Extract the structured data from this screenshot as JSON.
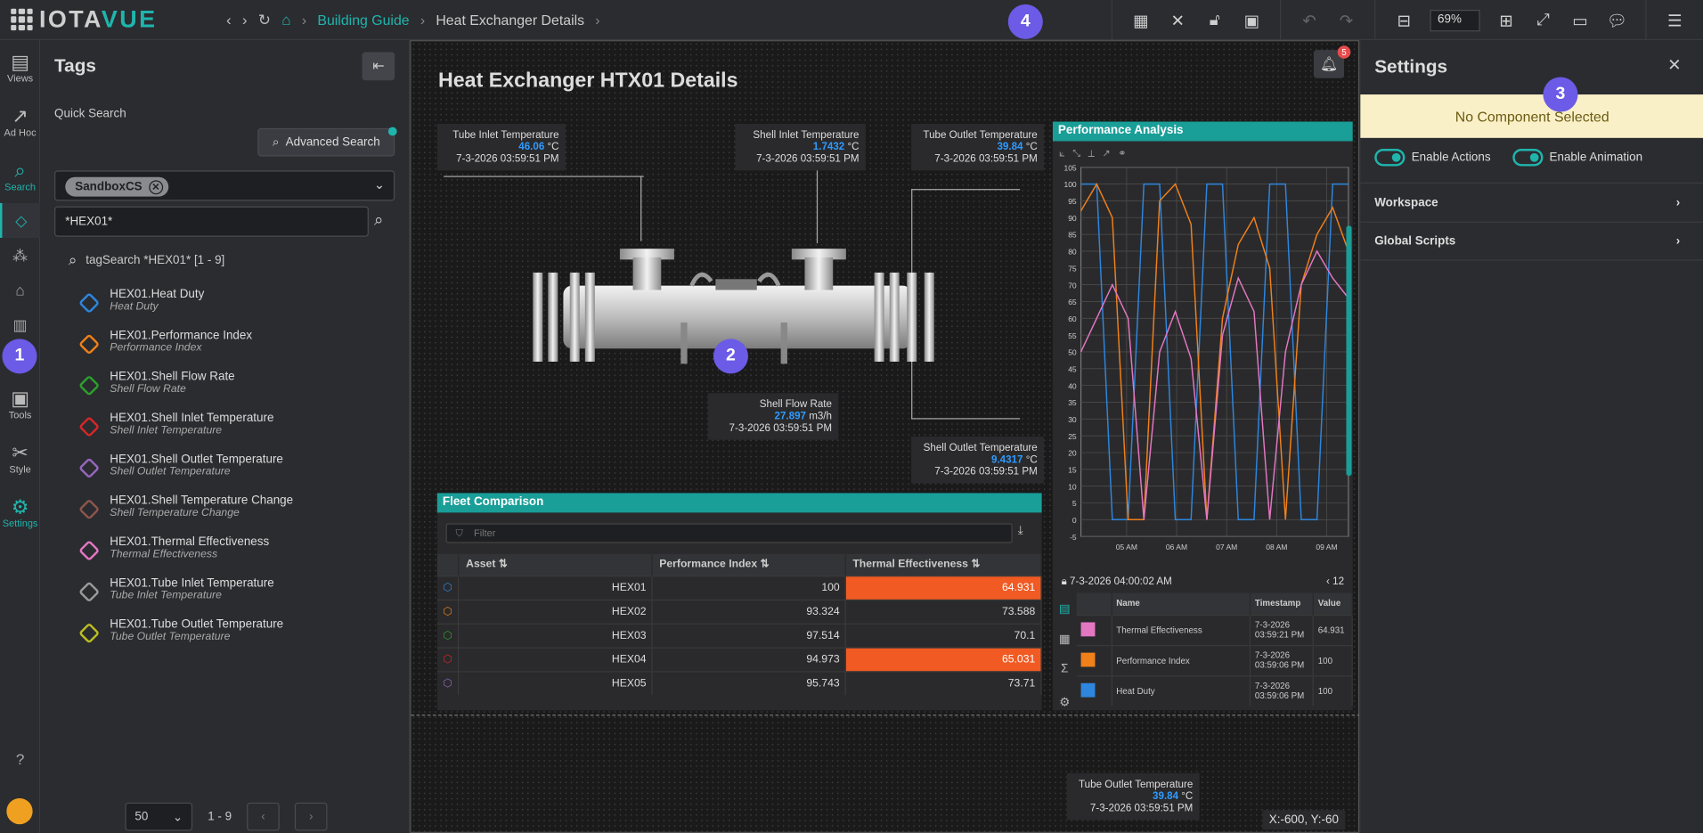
{
  "app": {
    "logo_part1": "IOTA",
    "logo_part2": "VUE"
  },
  "breadcrumb": {
    "home_link": "Building Guide",
    "current": "Heat Exchanger Details"
  },
  "toolbar": {
    "zoom": "69%"
  },
  "steps": {
    "one": "1",
    "two": "2",
    "three": "3",
    "four": "4"
  },
  "rail": [
    {
      "label": "Views"
    },
    {
      "label": "Ad Hoc"
    },
    {
      "label": "Search"
    },
    {
      "label": "Tools"
    },
    {
      "label": "Style"
    },
    {
      "label": "Settings"
    }
  ],
  "tags_panel": {
    "title": "Tags",
    "quick_search_label": "Quick Search",
    "advanced_search": "Advanced Search",
    "chip": "SandboxCS",
    "search_value": "*HEX01*",
    "tagsearch_text": "tagSearch *HEX01* [1 - 9]",
    "items": [
      {
        "name": "HEX01.Heat Duty",
        "desc": "Heat Duty",
        "color": "#2e86de"
      },
      {
        "name": "HEX01.Performance Index",
        "desc": "Performance Index",
        "color": "#f0801a"
      },
      {
        "name": "HEX01.Shell Flow Rate",
        "desc": "Shell Flow Rate",
        "color": "#2ca02c"
      },
      {
        "name": "HEX01.Shell Inlet Temperature",
        "desc": "Shell Inlet Temperature",
        "color": "#d62728"
      },
      {
        "name": "HEX01.Shell Outlet Temperature",
        "desc": "Shell Outlet Temperature",
        "color": "#9467bd"
      },
      {
        "name": "HEX01.Shell Temperature Change",
        "desc": "Shell Temperature Change",
        "color": "#8c564b"
      },
      {
        "name": "HEX01.Thermal Effectiveness",
        "desc": "Thermal Effectiveness",
        "color": "#e377c2"
      },
      {
        "name": "HEX01.Tube Inlet Temperature",
        "desc": "Tube Inlet Temperature",
        "color": "#9a9a9a"
      },
      {
        "name": "HEX01.Tube Outlet Temperature",
        "desc": "Tube Outlet Temperature",
        "color": "#bcbd22"
      }
    ],
    "page_size": "50",
    "range": "1 - 9"
  },
  "canvas": {
    "title": "Heat Exchanger HTX01 Details",
    "bell_count": "5",
    "readouts": {
      "tube_inlet": {
        "label": "Tube Inlet Temperature",
        "value": "46.06",
        "unit": "°C",
        "time": "7-3-2026 03:59:51 PM"
      },
      "shell_inlet": {
        "label": "Shell Inlet Temperature",
        "value": "1.7432",
        "unit": "°C",
        "time": "7-3-2026 03:59:51 PM"
      },
      "tube_outlet": {
        "label": "Tube Outlet Temperature",
        "value": "39.84",
        "unit": "°C",
        "time": "7-3-2026 03:59:51 PM"
      },
      "shell_flow": {
        "label": "Shell Flow Rate",
        "value": "27.897",
        "unit": "m3/h",
        "time": "7-3-2026 03:59:51 PM"
      },
      "shell_outlet": {
        "label": "Shell Outlet Temperature",
        "value": "9.4317",
        "unit": "°C",
        "time": "7-3-2026 03:59:51 PM"
      },
      "tube_outlet_2": {
        "label": "Tube Outlet Temperature",
        "value": "39.84",
        "unit": "°C",
        "time": "7-3-2026 03:59:51 PM"
      }
    },
    "coords": "X:-600, Y:-60"
  },
  "fleet": {
    "title": "Fleet Comparison",
    "filter_placeholder": "Filter",
    "columns": [
      "Asset",
      "Performance Index",
      "Thermal Effectiveness"
    ],
    "rows": [
      {
        "asset": "HEX01",
        "pi": "100",
        "te": "64.931",
        "hot": true,
        "color": "#2e86de"
      },
      {
        "asset": "HEX02",
        "pi": "93.324",
        "te": "73.588",
        "hot": false,
        "color": "#f0801a"
      },
      {
        "asset": "HEX03",
        "pi": "97.514",
        "te": "70.1",
        "hot": false,
        "color": "#2ca02c"
      },
      {
        "asset": "HEX04",
        "pi": "94.973",
        "te": "65.031",
        "hot": true,
        "color": "#d62728"
      },
      {
        "asset": "HEX05",
        "pi": "95.743",
        "te": "73.71",
        "hot": false,
        "color": "#9467bd"
      }
    ]
  },
  "perf": {
    "title": "Performance Analysis",
    "timestamp": "7-3-2026 04:00:02 AM",
    "legend_cols": [
      "Name",
      "Timestamp",
      "Value"
    ],
    "legend": [
      {
        "name": "Thermal Effectiveness",
        "ts1": "7-3-2026",
        "ts2": "03:59:21 PM",
        "value": "64.931",
        "color": "#e377c2"
      },
      {
        "name": "Performance Index",
        "ts1": "7-3-2026",
        "ts2": "03:59:06 PM",
        "value": "100",
        "color": "#f0801a"
      },
      {
        "name": "Heat Duty",
        "ts1": "7-3-2026",
        "ts2": "03:59:06 PM",
        "value": "100",
        "color": "#2e86de"
      }
    ]
  },
  "chart_data": {
    "type": "line",
    "x": [
      "05 AM",
      "06 AM",
      "07 AM",
      "08 AM",
      "09 AM"
    ],
    "ylim": [
      -5,
      105
    ],
    "yticks": [
      -5,
      0,
      5,
      10,
      15,
      20,
      25,
      30,
      35,
      40,
      45,
      50,
      55,
      60,
      65,
      70,
      75,
      80,
      85,
      90,
      95,
      100,
      105
    ],
    "series": [
      {
        "name": "Heat Duty",
        "color": "#2e86de",
        "values": [
          100,
          100,
          0,
          0,
          100,
          100,
          0,
          0,
          100,
          100,
          0,
          0,
          100,
          100,
          0,
          0,
          100,
          100
        ]
      },
      {
        "name": "Performance Index",
        "color": "#f0801a",
        "values": [
          92,
          100,
          90,
          0,
          0,
          95,
          100,
          88,
          0,
          60,
          82,
          90,
          75,
          0,
          70,
          85,
          93,
          80
        ]
      },
      {
        "name": "Thermal Effectiveness",
        "color": "#e377c2",
        "values": [
          50,
          60,
          70,
          60,
          0,
          50,
          62,
          48,
          0,
          55,
          72,
          62,
          0,
          50,
          70,
          80,
          72,
          66
        ]
      }
    ]
  },
  "settings": {
    "title": "Settings",
    "no_component": "No Component Selected",
    "enable_actions": "Enable Actions",
    "enable_animation": "Enable Animation",
    "workspace": "Workspace",
    "global_scripts": "Global Scripts"
  }
}
